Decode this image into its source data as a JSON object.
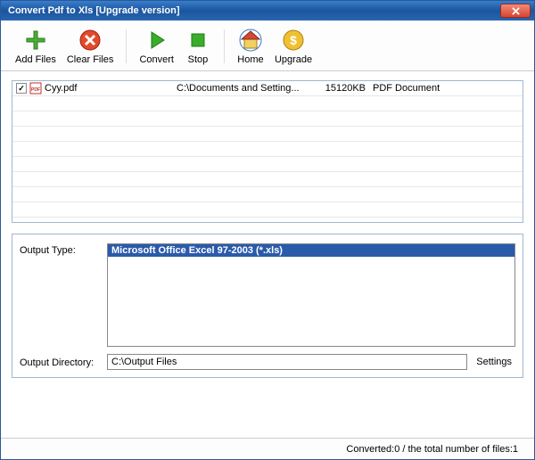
{
  "window": {
    "title": "Convert Pdf to Xls [Upgrade version]"
  },
  "toolbar": {
    "add_files": "Add Files",
    "clear_files": "Clear Files",
    "convert": "Convert",
    "stop": "Stop",
    "home": "Home",
    "upgrade": "Upgrade"
  },
  "files": [
    {
      "checked": true,
      "name": "Cyy.pdf",
      "path": "C:\\Documents and Setting...",
      "size": "15120KB",
      "type": "PDF Document"
    }
  ],
  "output": {
    "type_label": "Output Type:",
    "type_selected": "Microsoft Office Excel 97-2003 (*.xls)",
    "dir_label": "Output Directory:",
    "dir_value": "C:\\Output Files",
    "settings_label": "Settings"
  },
  "status": {
    "text": "Converted:0  /  the total number of files:1"
  }
}
